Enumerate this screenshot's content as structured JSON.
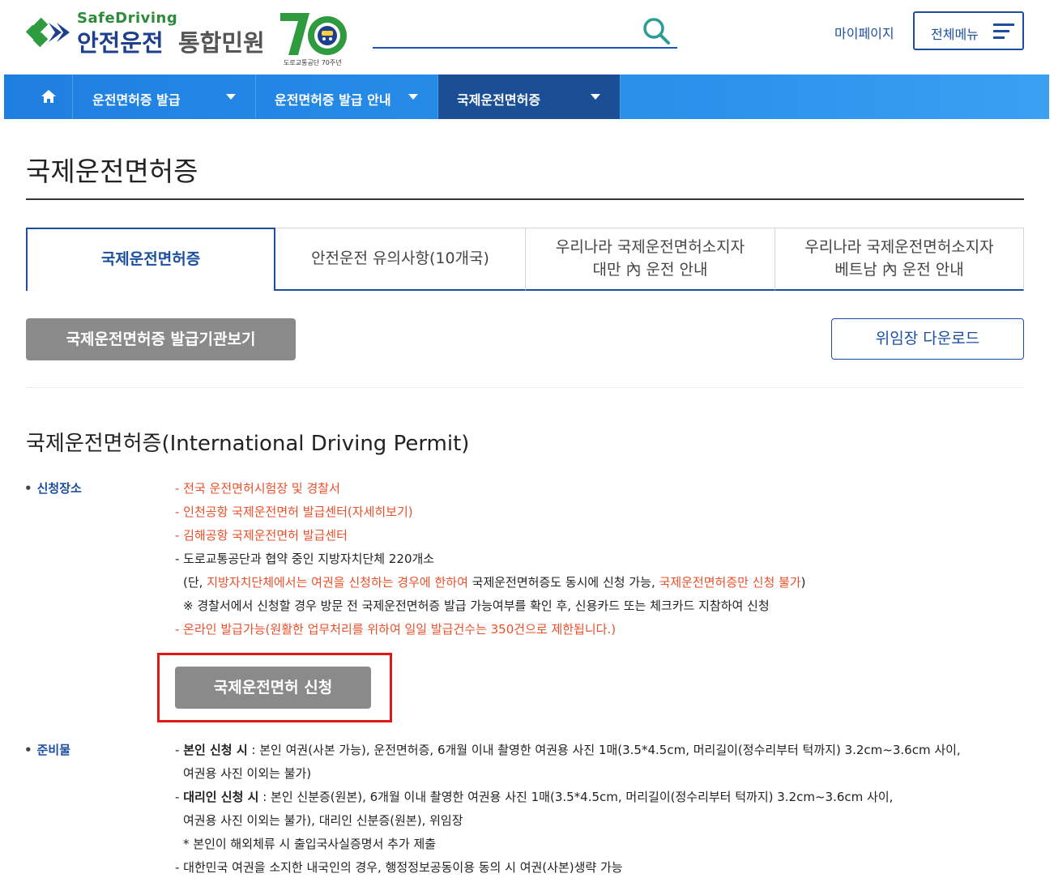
{
  "header": {
    "logo_sub": "SafeDriving",
    "logo_main": "안전운전",
    "logo_main2": "통합민원",
    "logo_70_caption": "도로교통공단 70주년",
    "mypage_label": "마이페이지",
    "allmenu_label": "전체메뉴"
  },
  "nav": {
    "items": [
      {
        "label": "운전면허증 발급"
      },
      {
        "label": "운전면허증 발급 안내"
      },
      {
        "label": "국제운전면허증"
      }
    ]
  },
  "page": {
    "title": "국제운전면허증"
  },
  "tabs": [
    {
      "line1": "국제운전면허증",
      "line2": ""
    },
    {
      "line1": "안전운전 유의사항(10개국)",
      "line2": ""
    },
    {
      "line1": "우리나라 국제운전면허소지자",
      "line2": "대만 內 운전 안내"
    },
    {
      "line1": "우리나라 국제운전면허소지자",
      "line2": "베트남 內 운전 안내"
    }
  ],
  "actions": {
    "issuers_button": "국제운전면허증 발급기관보기",
    "proxy_download": "위임장 다운로드",
    "apply_button": "국제운전면허 신청"
  },
  "section": {
    "title": "국제운전면허증(International Driving Permit)",
    "place_label": "신청장소",
    "place": {
      "l1": "- 전국 운전면허시험장 및 경찰서",
      "l2": "- 인천공항 국제운전면허 발급센터(자세히보기)",
      "l3": "- 김해공항 국제운전면허 발급센터",
      "l4": "- 도로교통공단과 협약 중인 지방자치단체 220개소",
      "l5a": "(단, ",
      "l5b": "지방자치단체에서는 여권을 신청하는 경우에 한하여",
      "l5c": " 국제운전면허증도 동시에 신청 가능, ",
      "l5d": "국제운전면허증만 신청 불가",
      "l5e": ")",
      "l6": "※ 경찰서에서 신청할 경우 방문 전 국제운전면허증 발급 가능여부를 확인 후, 신용카드 또는 체크카드 지참하여 신청",
      "l7": "- 온라인 발급가능(원활한 업무처리를 위하여 일일 발급건수는 350건으로 제한됩니다.)"
    },
    "prep_label": "준비물",
    "prep": {
      "p1a": "- ",
      "p1b": "본인 신청 시",
      "p1c": " : 본인 여권(사본 가능), 운전면허증, 6개월 이내 촬영한 여권용 사진 1매(3.5*4.5cm, 머리길이(정수리부터 턱까지) 3.2cm~3.6cm 사이,",
      "p2": "여권용 사진 이외는 불가)",
      "p3a": "- ",
      "p3b": "대리인 신청 시",
      "p3c": " : 본인 신분증(원본), 6개월 이내 촬영한 여권용 사진 1매(3.5*4.5cm, 머리길이(정수리부터 턱까지) 3.2cm~3.6cm 사이,",
      "p4": "여권용 사진 이외는 불가), 대리인 신분증(원본), 위임장",
      "p5": "* 본인이 해외체류 시 출입국사실증명서 추가 제출",
      "p6": "- 대한민국 여권을 소지한 내국인의 경우, 행정정보공동이용 동의 시 여권(사본)생략 가능"
    }
  },
  "colors": {
    "brand_blue": "#1d4fa0",
    "nav_blue": "#2b93ec",
    "nav_active": "#1a4f96",
    "accent_red": "#e8502a",
    "highlight_box": "#e01818"
  }
}
